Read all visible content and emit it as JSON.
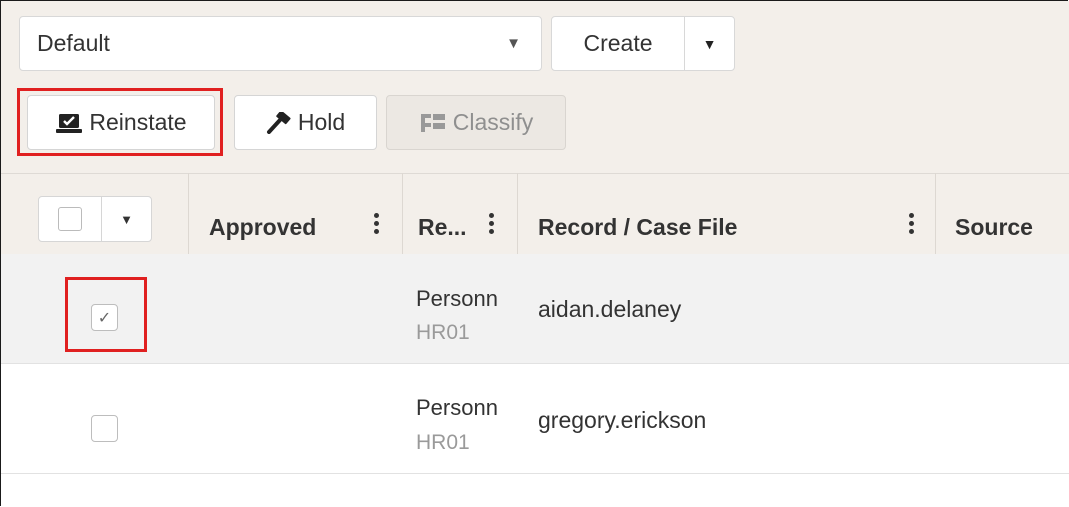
{
  "view_select": {
    "value": "Default"
  },
  "create_button": {
    "label": "Create"
  },
  "actions": {
    "reinstate": "Reinstate",
    "hold": "Hold",
    "classify": "Classify"
  },
  "table": {
    "columns": [
      "Approved",
      "Re...",
      "Record / Case File",
      "Source"
    ],
    "rows": [
      {
        "type": "Personn",
        "code": "HR01",
        "record": "aidan.delaney",
        "checked": true,
        "checkmark": "✓"
      },
      {
        "type": "Personn",
        "code": "HR01",
        "record": "gregory.erickson",
        "checked": false,
        "checkmark": ""
      }
    ]
  },
  "colors": {
    "highlight": "#e02020",
    "toolbar_bg": "#f3efea",
    "selected_row": "#f2f2f2"
  }
}
